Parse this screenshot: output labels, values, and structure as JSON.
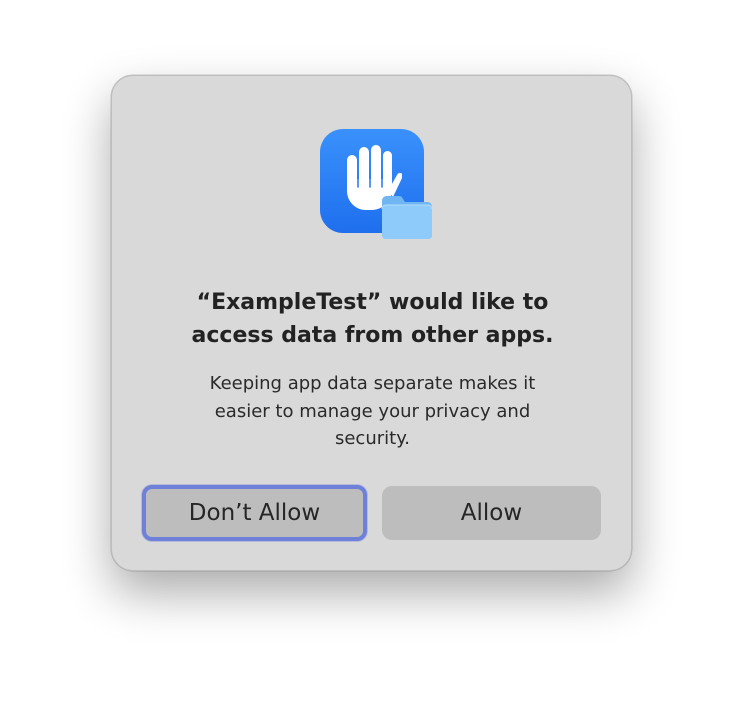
{
  "dialog": {
    "title_line1": "“ExampleTest” would like to",
    "title_line2": "access data from other apps.",
    "message_line1": "Keeping app data separate makes it",
    "message_line2": "easier to manage your privacy and",
    "message_line3": "security.",
    "icon": "privacy-hand-icon",
    "badge_icon": "folder-icon",
    "buttons": {
      "dont_allow": "Don’t Allow",
      "allow": "Allow"
    }
  },
  "colors": {
    "dialog_background": "#d9d9d9",
    "icon_blue": "#2a7ff6",
    "focus_ring": "#6f80d9",
    "button_background": "#bdbdbd"
  }
}
